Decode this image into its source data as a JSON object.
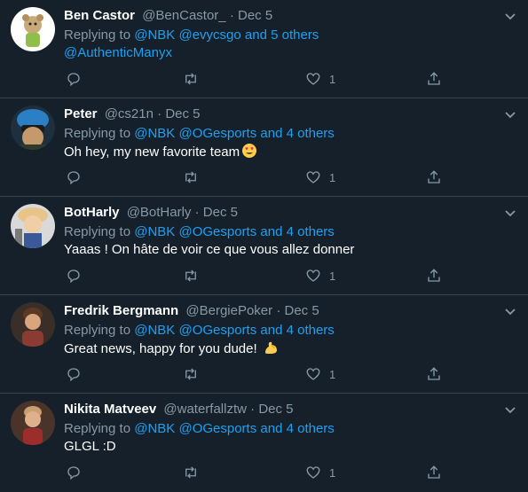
{
  "colors": {
    "background": "#15202b",
    "link": "#1da1f2",
    "muted": "#8899a6",
    "divider": "#38444d"
  },
  "tweets": [
    {
      "name": "Ben Castor",
      "handle": "@BenCastor_",
      "dot": "·",
      "date": "Dec 5",
      "reply_prefix": "Replying to",
      "reply_links": [
        "@NBK",
        "@evycsgo",
        "and 5 others",
        "@AuthenticManyx"
      ],
      "text": "",
      "likes": "1"
    },
    {
      "name": "Peter",
      "handle": "@cs21n",
      "dot": "·",
      "date": "Dec 5",
      "reply_prefix": "Replying to",
      "reply_links": [
        "@NBK",
        "@OGesports",
        "and 4 others"
      ],
      "text": "Oh hey, my new favorite team",
      "likes": "1"
    },
    {
      "name": "BotHarly",
      "handle": "@BotHarly",
      "dot": "·",
      "date": "Dec 5",
      "reply_prefix": "Replying to",
      "reply_links": [
        "@NBK",
        "@OGesports",
        "and 4 others"
      ],
      "text": "Yaaas ! On hâte de voir ce que vous allez donner",
      "likes": "1"
    },
    {
      "name": "Fredrik Bergmann",
      "handle": "@BergiePoker",
      "dot": "·",
      "date": "Dec 5",
      "reply_prefix": "Replying to",
      "reply_links": [
        "@NBK",
        "@OGesports",
        "and 4 others"
      ],
      "text": "Great news, happy for you dude!",
      "likes": "1"
    },
    {
      "name": "Nikita Matveev",
      "handle": "@waterfallztw",
      "dot": "·",
      "date": "Dec 5",
      "reply_prefix": "Replying to",
      "reply_links": [
        "@NBK",
        "@OGesports",
        "and 4 others"
      ],
      "text": "GLGL :D",
      "likes": "1"
    }
  ]
}
